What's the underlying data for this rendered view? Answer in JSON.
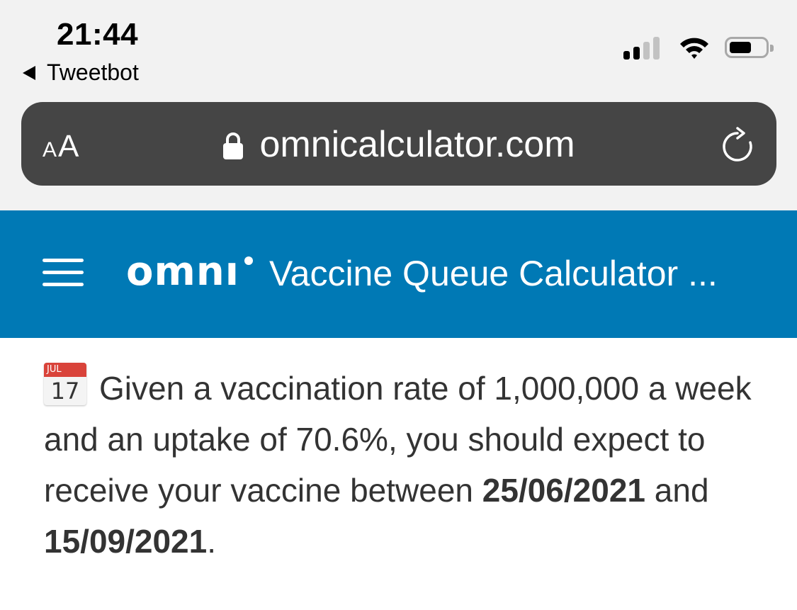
{
  "status_bar": {
    "time": "21:44",
    "back_app": "Tweetbot"
  },
  "url_bar": {
    "text_size_small": "A",
    "text_size_large": "A",
    "domain": "omnicalculator.com"
  },
  "header": {
    "logo": "omnı",
    "title": "Vaccine Queue Calculator ..."
  },
  "content": {
    "calendar_month": "JUL",
    "calendar_day": "17",
    "sentence_start": "Given a vaccination rate of 1,000,000 a week and an uptake of 70.6%, you should expect to receive your vaccine between",
    "date_start": "25/06/2021",
    "conjunction": "and",
    "date_end": "15/09/2021",
    "period": "."
  },
  "colors": {
    "header_bg": "#0079b5",
    "url_bar_bg": "#454545",
    "top_bg": "#f2f2f2"
  }
}
